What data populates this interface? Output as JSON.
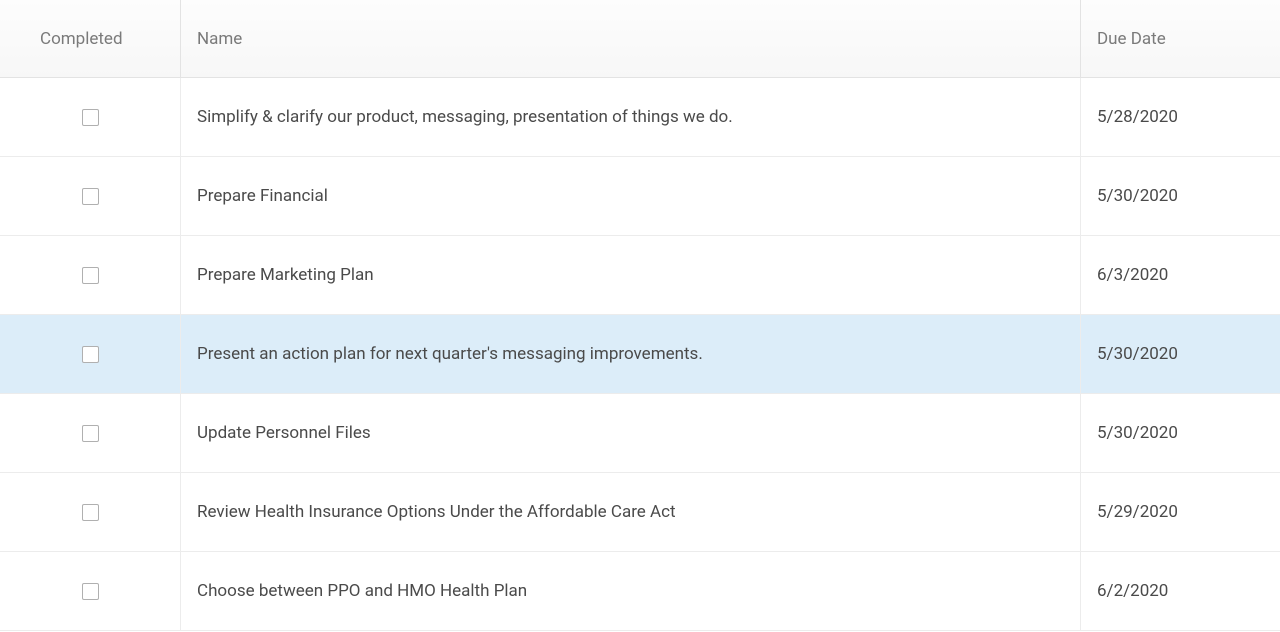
{
  "columns": {
    "completed": "Completed",
    "name": "Name",
    "due_date": "Due Date"
  },
  "rows": [
    {
      "completed": false,
      "name": "Simplify & clarify our product, messaging, presentation of things we do.",
      "due_date": "5/28/2020",
      "highlighted": false
    },
    {
      "completed": false,
      "name": "Prepare Financial",
      "due_date": "5/30/2020",
      "highlighted": false
    },
    {
      "completed": false,
      "name": "Prepare Marketing Plan",
      "due_date": "6/3/2020",
      "highlighted": false
    },
    {
      "completed": false,
      "name": "Present an action plan for next quarter's messaging improvements.",
      "due_date": "5/30/2020",
      "highlighted": true
    },
    {
      "completed": false,
      "name": "Update Personnel Files",
      "due_date": "5/30/2020",
      "highlighted": false
    },
    {
      "completed": false,
      "name": "Review Health Insurance Options Under the Affordable Care Act",
      "due_date": "5/29/2020",
      "highlighted": false
    },
    {
      "completed": false,
      "name": "Choose between PPO and HMO Health Plan",
      "due_date": "6/2/2020",
      "highlighted": false
    }
  ]
}
